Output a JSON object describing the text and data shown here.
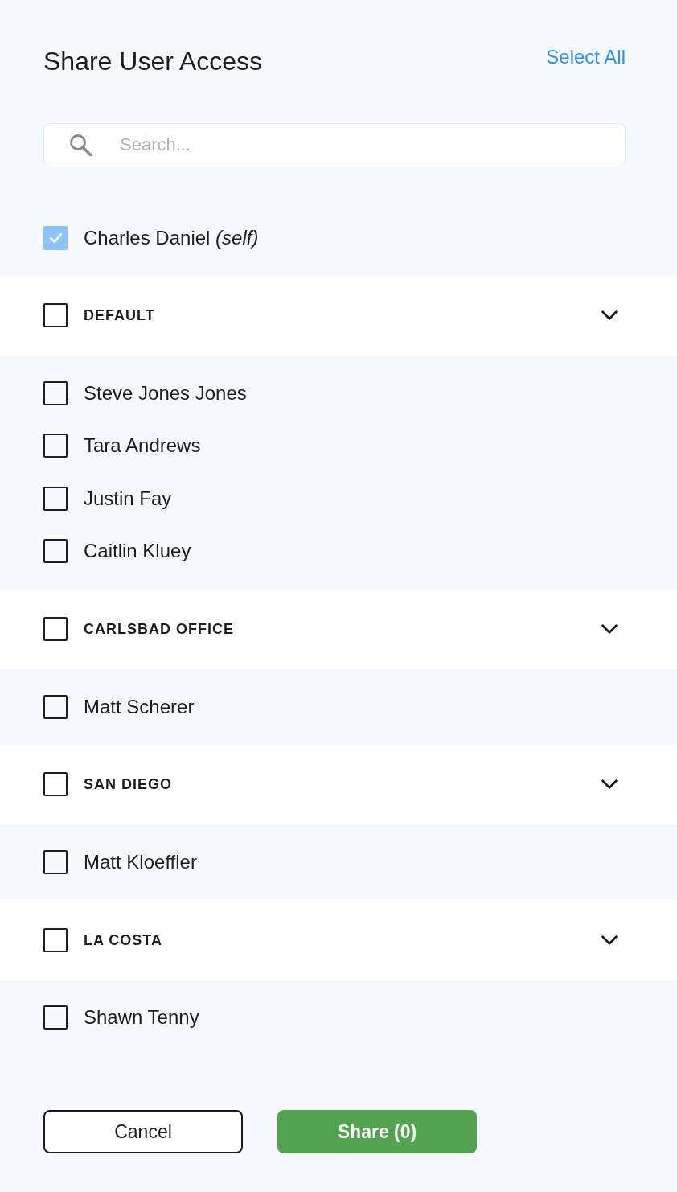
{
  "dialog": {
    "title": "Share User Access",
    "select_all": "Select All"
  },
  "search": {
    "placeholder": "Search..."
  },
  "self_user": {
    "name": "Charles Daniel *(self)*",
    "checked": true
  },
  "groups": [
    {
      "name": "DEFAULT",
      "checked": false,
      "expanded": true,
      "members": [
        {
          "name": "Steve Jones Jones",
          "checked": false
        },
        {
          "name": "Tara Andrews",
          "checked": false
        },
        {
          "name": "Justin Fay",
          "checked": false
        },
        {
          "name": "Caitlin Kluey",
          "checked": false
        }
      ]
    },
    {
      "name": "CARLSBAD OFFICE",
      "checked": false,
      "expanded": true,
      "members": [
        {
          "name": "Matt Scherer",
          "checked": false
        }
      ]
    },
    {
      "name": "SAN DIEGO",
      "checked": false,
      "expanded": true,
      "members": [
        {
          "name": "Matt Kloeffler",
          "checked": false
        }
      ]
    },
    {
      "name": "LA COSTA",
      "checked": false,
      "expanded": true,
      "members": [
        {
          "name": "Shawn Tenny",
          "checked": false
        }
      ]
    }
  ],
  "buttons": [
    {
      "label": "Cancel",
      "kind": "secondary"
    },
    {
      "label": "Share (0)",
      "kind": "primary"
    }
  ]
}
